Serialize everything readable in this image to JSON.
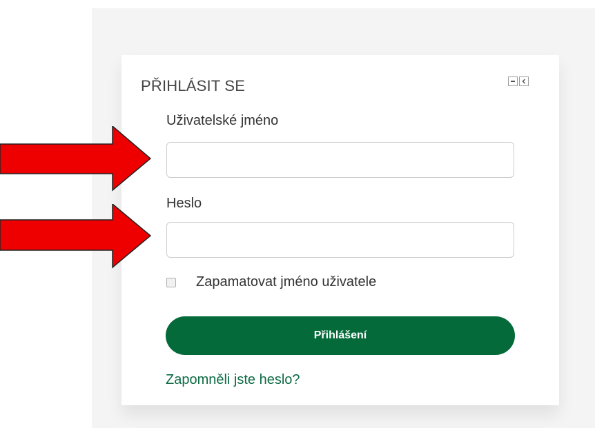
{
  "login_block": {
    "title": "PŘIHLÁSIT SE",
    "controls": [
      {
        "icon": "minus-icon"
      },
      {
        "icon": "dock-left-icon"
      }
    ],
    "username": {
      "label": "Uživatelské jméno",
      "value": "",
      "placeholder": ""
    },
    "password": {
      "label": "Heslo",
      "value": "",
      "placeholder": ""
    },
    "remember": {
      "label": "Zapamatovat jméno uživatele",
      "checked": false
    },
    "submit_label": "Přihlášení",
    "forgot_link": "Zapomněli jste heslo?"
  },
  "annotations": {
    "arrow_color": "#ee0000",
    "arrows": [
      {
        "points_to": "username-input",
        "icon": "arrow-right-icon"
      },
      {
        "points_to": "password-input",
        "icon": "arrow-right-icon"
      }
    ]
  },
  "colors": {
    "accent": "#046a3a",
    "link": "#0d6b44",
    "page_background": "#f4f4f4"
  }
}
